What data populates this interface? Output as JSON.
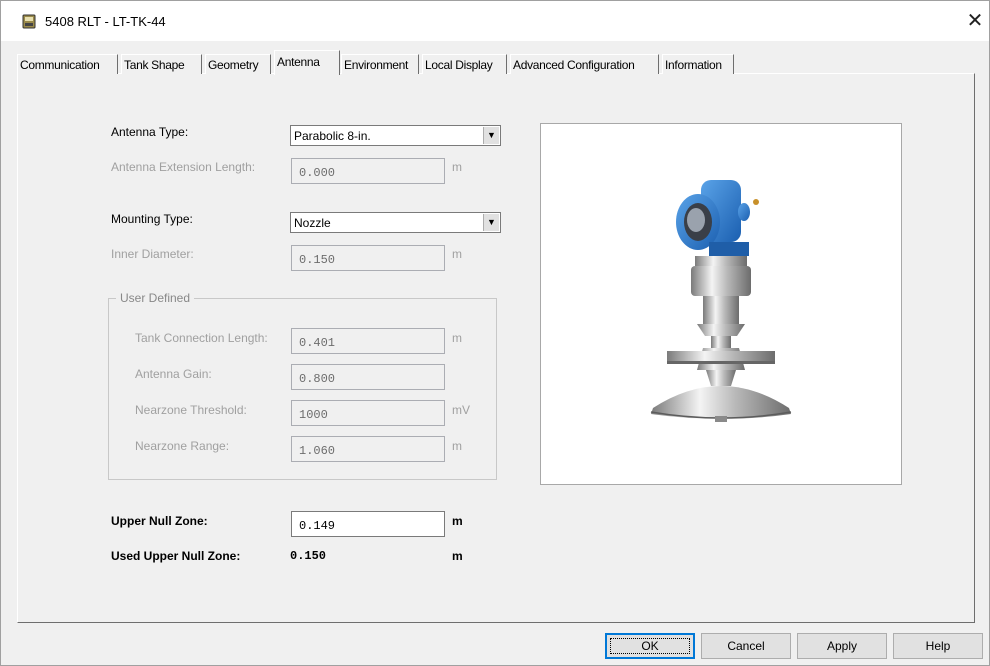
{
  "window": {
    "title": "5408 RLT  - LT-TK-44",
    "close_glyph": "✕"
  },
  "tabs": [
    {
      "label": "Communication"
    },
    {
      "label": "Tank Shape"
    },
    {
      "label": "Geometry"
    },
    {
      "label": "Antenna"
    },
    {
      "label": "Environment"
    },
    {
      "label": "Local Display"
    },
    {
      "label": "Advanced Configuration"
    },
    {
      "label": "Information"
    }
  ],
  "form": {
    "antenna_type": {
      "label": "Antenna Type:",
      "value": "Parabolic 8-in."
    },
    "antenna_extension_length": {
      "label": "Antenna Extension Length:",
      "value": "0.000",
      "unit": "m"
    },
    "mounting_type": {
      "label": "Mounting Type:",
      "value": "Nozzle"
    },
    "inner_diameter": {
      "label": "Inner Diameter:",
      "value": "0.150",
      "unit": "m"
    },
    "user_defined": {
      "title": "User Defined",
      "tank_connection_length": {
        "label": "Tank Connection Length:",
        "value": "0.401",
        "unit": "m"
      },
      "antenna_gain": {
        "label": "Antenna Gain:",
        "value": "0.800"
      },
      "nearzone_threshold": {
        "label": "Nearzone Threshold:",
        "value": "1000",
        "unit": "mV"
      },
      "nearzone_range": {
        "label": "Nearzone Range:",
        "value": "1.060",
        "unit": "m"
      }
    },
    "upper_null_zone": {
      "label": "Upper Null Zone:",
      "value": "0.149",
      "unit": "m"
    },
    "used_upper_null_zone": {
      "label": "Used Upper Null Zone:",
      "value": "0.150",
      "unit": "m"
    }
  },
  "buttons": {
    "ok": "OK",
    "cancel": "Cancel",
    "apply": "Apply",
    "help": "Help"
  }
}
